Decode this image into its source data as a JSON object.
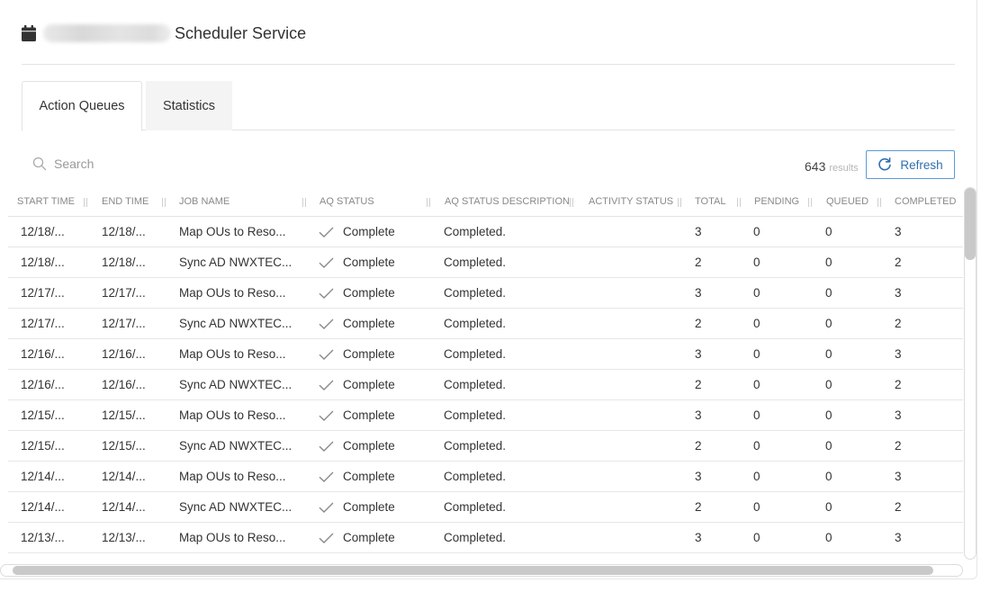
{
  "header": {
    "title": "Scheduler Service",
    "icon": "calendar-icon"
  },
  "tabs": [
    {
      "label": "Action Queues",
      "active": true
    },
    {
      "label": "Statistics",
      "active": false
    }
  ],
  "toolbar": {
    "search_placeholder": "Search",
    "results_count": "643",
    "results_label": "results",
    "refresh_label": "Refresh"
  },
  "columns": [
    "START TIME",
    "END TIME",
    "JOB NAME",
    "AQ STATUS",
    "AQ STATUS DESCRIPTION",
    "ACTIVITY STATUS",
    "TOTAL",
    "PENDING",
    "QUEUED",
    "COMPLETED"
  ],
  "rows": [
    {
      "start": "12/18/...",
      "end": "12/18/...",
      "job": "Map OUs to Reso...",
      "status": "Complete",
      "desc": "Completed.",
      "activity": "",
      "total": "3",
      "pending": "0",
      "queued": "0",
      "completed": "3"
    },
    {
      "start": "12/18/...",
      "end": "12/18/...",
      "job": "Sync AD NWXTEC...",
      "status": "Complete",
      "desc": "Completed.",
      "activity": "",
      "total": "2",
      "pending": "0",
      "queued": "0",
      "completed": "2"
    },
    {
      "start": "12/17/...",
      "end": "12/17/...",
      "job": "Map OUs to Reso...",
      "status": "Complete",
      "desc": "Completed.",
      "activity": "",
      "total": "3",
      "pending": "0",
      "queued": "0",
      "completed": "3"
    },
    {
      "start": "12/17/...",
      "end": "12/17/...",
      "job": "Sync AD NWXTEC...",
      "status": "Complete",
      "desc": "Completed.",
      "activity": "",
      "total": "2",
      "pending": "0",
      "queued": "0",
      "completed": "2"
    },
    {
      "start": "12/16/...",
      "end": "12/16/...",
      "job": "Map OUs to Reso...",
      "status": "Complete",
      "desc": "Completed.",
      "activity": "",
      "total": "3",
      "pending": "0",
      "queued": "0",
      "completed": "3"
    },
    {
      "start": "12/16/...",
      "end": "12/16/...",
      "job": "Sync AD NWXTEC...",
      "status": "Complete",
      "desc": "Completed.",
      "activity": "",
      "total": "2",
      "pending": "0",
      "queued": "0",
      "completed": "2"
    },
    {
      "start": "12/15/...",
      "end": "12/15/...",
      "job": "Map OUs to Reso...",
      "status": "Complete",
      "desc": "Completed.",
      "activity": "",
      "total": "3",
      "pending": "0",
      "queued": "0",
      "completed": "3"
    },
    {
      "start": "12/15/...",
      "end": "12/15/...",
      "job": "Sync AD NWXTEC...",
      "status": "Complete",
      "desc": "Completed.",
      "activity": "",
      "total": "2",
      "pending": "0",
      "queued": "0",
      "completed": "2"
    },
    {
      "start": "12/14/...",
      "end": "12/14/...",
      "job": "Map OUs to Reso...",
      "status": "Complete",
      "desc": "Completed.",
      "activity": "",
      "total": "3",
      "pending": "0",
      "queued": "0",
      "completed": "3"
    },
    {
      "start": "12/14/...",
      "end": "12/14/...",
      "job": "Sync AD NWXTEC...",
      "status": "Complete",
      "desc": "Completed.",
      "activity": "",
      "total": "2",
      "pending": "0",
      "queued": "0",
      "completed": "2"
    },
    {
      "start": "12/13/...",
      "end": "12/13/...",
      "job": "Map OUs to Reso...",
      "status": "Complete",
      "desc": "Completed.",
      "activity": "",
      "total": "3",
      "pending": "0",
      "queued": "0",
      "completed": "3"
    }
  ],
  "colors": {
    "accent": "#2f6fad",
    "accent_border": "#5b9bd5",
    "header_text": "#888888",
    "check": "#8a8a8a"
  }
}
